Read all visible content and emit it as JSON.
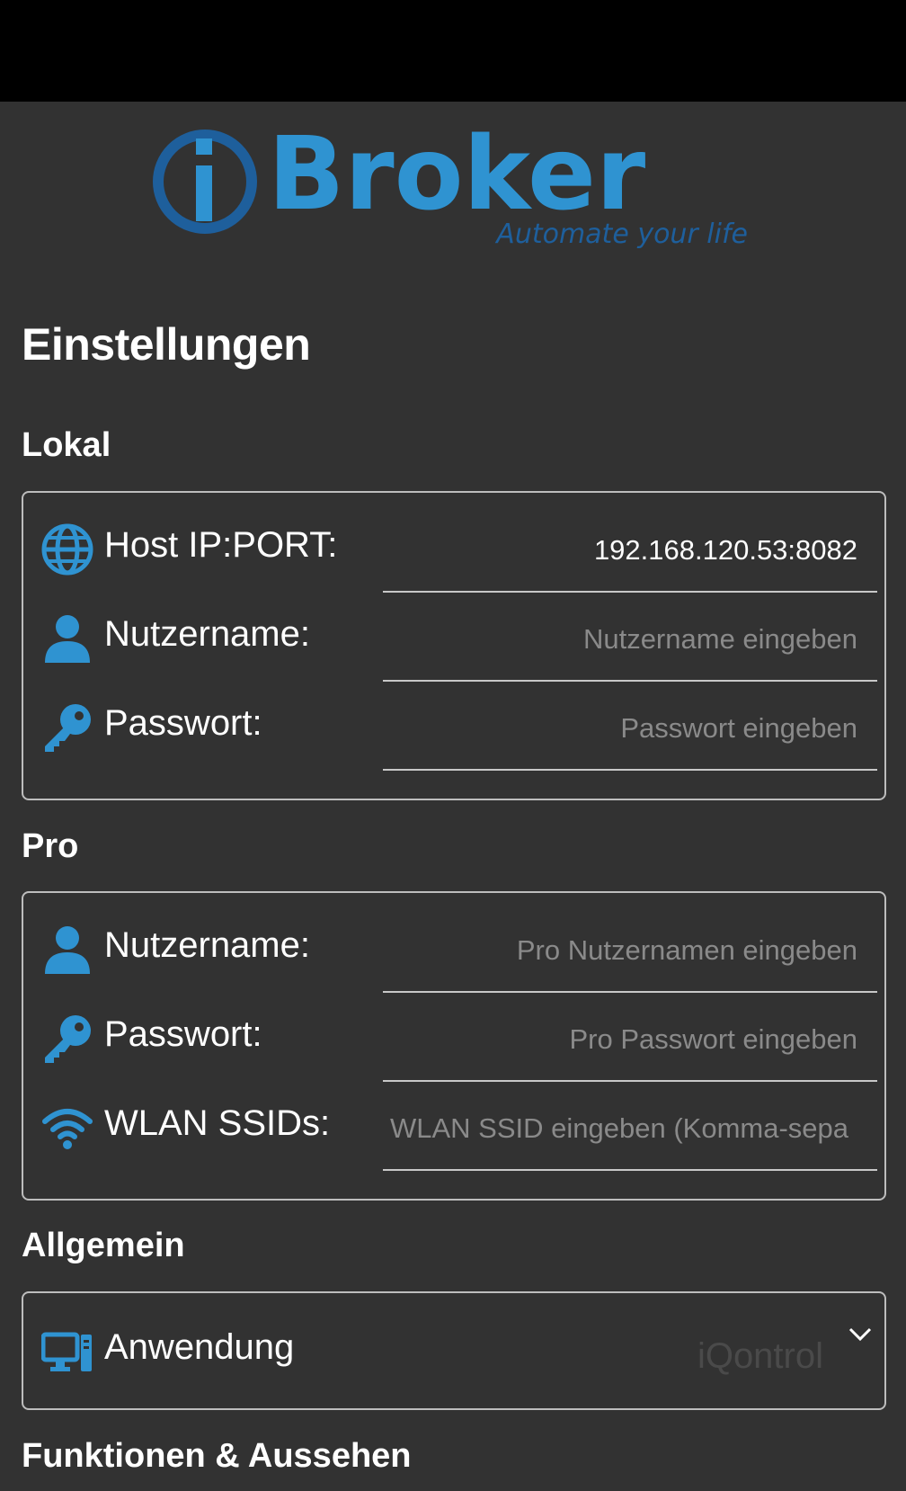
{
  "brand": {
    "name": "Broker",
    "tagline": "Automate your life",
    "logo_color": "#2f93d1"
  },
  "page": {
    "title": "Einstellungen"
  },
  "sections": {
    "lokal": {
      "title": "Lokal",
      "host": {
        "label": "Host IP:PORT:",
        "value": "192.168.120.53:8082",
        "placeholder": "",
        "icon": "globe-icon"
      },
      "username": {
        "label": "Nutzername:",
        "value": "",
        "placeholder": "Nutzername eingeben",
        "icon": "user-icon"
      },
      "password": {
        "label": "Passwort:",
        "value": "",
        "placeholder": "Passwort eingeben",
        "icon": "key-icon"
      }
    },
    "pro": {
      "title": "Pro",
      "username": {
        "label": "Nutzername:",
        "value": "",
        "placeholder": "Pro Nutzernamen eingeben",
        "icon": "user-icon"
      },
      "password": {
        "label": "Passwort:",
        "value": "",
        "placeholder": "Pro Passwort eingeben",
        "icon": "key-icon"
      },
      "ssids": {
        "label": "WLAN SSIDs:",
        "value": "",
        "placeholder": "WLAN SSID eingeben (Komma-sepa",
        "icon": "wifi-icon"
      }
    },
    "allgemein": {
      "title": "Allgemein",
      "app": {
        "label": "Anwendung",
        "selected": "iQontrol",
        "icon": "computer-icon"
      }
    },
    "funktionen": {
      "title": "Funktionen & Aussehen"
    }
  },
  "colors": {
    "accent": "#2f93d1",
    "background": "#323232"
  }
}
